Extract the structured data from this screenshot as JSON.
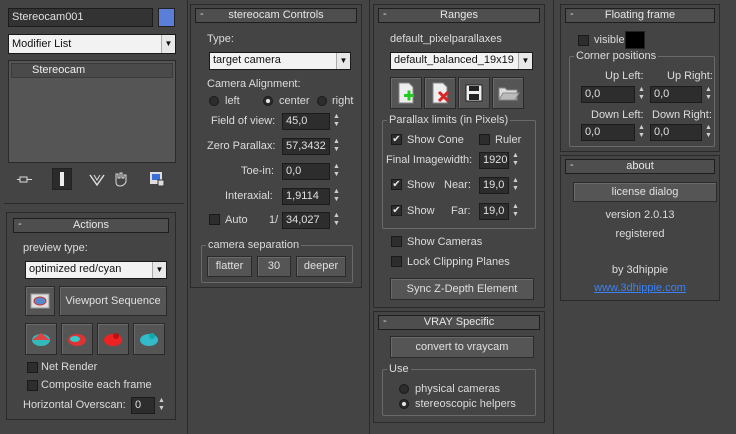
{
  "left": {
    "object_name": "Stereocam001",
    "color_swatch": "#5b7fd8",
    "modifier_list": "Modifier List",
    "stack_items": [
      "Stereocam"
    ],
    "toolbar_icons": [
      "pin-stack-icon",
      "show-end-result-icon",
      "make-unique-icon",
      "remove-modifier-icon",
      "configure-modifier-sets-icon"
    ]
  },
  "actions": {
    "title": "Actions",
    "preview_type_label": "preview type:",
    "preview_type_value": "optimized red/cyan",
    "viewport_sequence": "Viewport Sequence",
    "net_render": "Net Render",
    "composite_each_frame": "Composite each frame",
    "horizontal_overscan_label": "Horizontal Overscan:",
    "horizontal_overscan_value": "0"
  },
  "controls": {
    "title": "stereocam Controls",
    "type_label": "Type:",
    "type_value": "target camera",
    "alignment_label": "Camera Alignment:",
    "alignment_options": [
      "left",
      "center",
      "right"
    ],
    "alignment_selected": "center",
    "fov_label": "Field of view:",
    "fov_value": "45,0",
    "zero_parallax_label": "Zero Parallax:",
    "zero_parallax_value": "57,3432",
    "toe_in_label": "Toe-in:",
    "toe_in_value": "0,0",
    "interaxial_label": "Interaxial:",
    "interaxial_value": "1,9114",
    "auto_label": "Auto",
    "ratio_prefix": "1/",
    "ratio_value": "34,027",
    "separation_group": "camera separation",
    "flatter": "flatter",
    "separation_value": "30",
    "deeper": "deeper"
  },
  "ranges": {
    "title": "Ranges",
    "preset_name": "default_pixelparallaxes",
    "preset_value": "default_balanced_19x19",
    "preset_icons": [
      "add-preset-icon",
      "delete-preset-icon",
      "save-preset-icon",
      "open-folder-icon"
    ],
    "limits_group": "Parallax limits (in Pixels)",
    "show_cone": "Show Cone",
    "ruler": "Ruler",
    "final_imagewidth_label": "Final Imagewidth:",
    "final_imagewidth_value": "1920",
    "show_near_label": "Show",
    "near_label": "Near:",
    "near_value": "19,0",
    "show_far_label": "Show",
    "far_label": "Far:",
    "far_value": "19,0",
    "show_cameras": "Show Cameras",
    "lock_clipping": "Lock Clipping Planes",
    "sync_zdepth": "Sync Z-Depth Element"
  },
  "vray": {
    "title": "VRAY Specific",
    "convert": "convert to vraycam",
    "use_group": "Use",
    "options": [
      "physical cameras",
      "stereoscopic helpers"
    ],
    "selected": "stereoscopic helpers"
  },
  "floating": {
    "title": "Floating frame",
    "visible_label": "visible",
    "frame_color": "#000000",
    "corner_group": "Corner positions",
    "up_left_label": "Up Left:",
    "up_left_value": "0,0",
    "up_right_label": "Up Right:",
    "up_right_value": "0,0",
    "down_left_label": "Down Left:",
    "down_left_value": "0,0",
    "down_right_label": "Down Right:",
    "down_right_value": "0,0"
  },
  "about": {
    "title": "about",
    "license_dialog": "license dialog",
    "version": "version 2.0.13",
    "status": "registered",
    "by": "by 3dhippie",
    "url": "www.3dhippie.com"
  }
}
